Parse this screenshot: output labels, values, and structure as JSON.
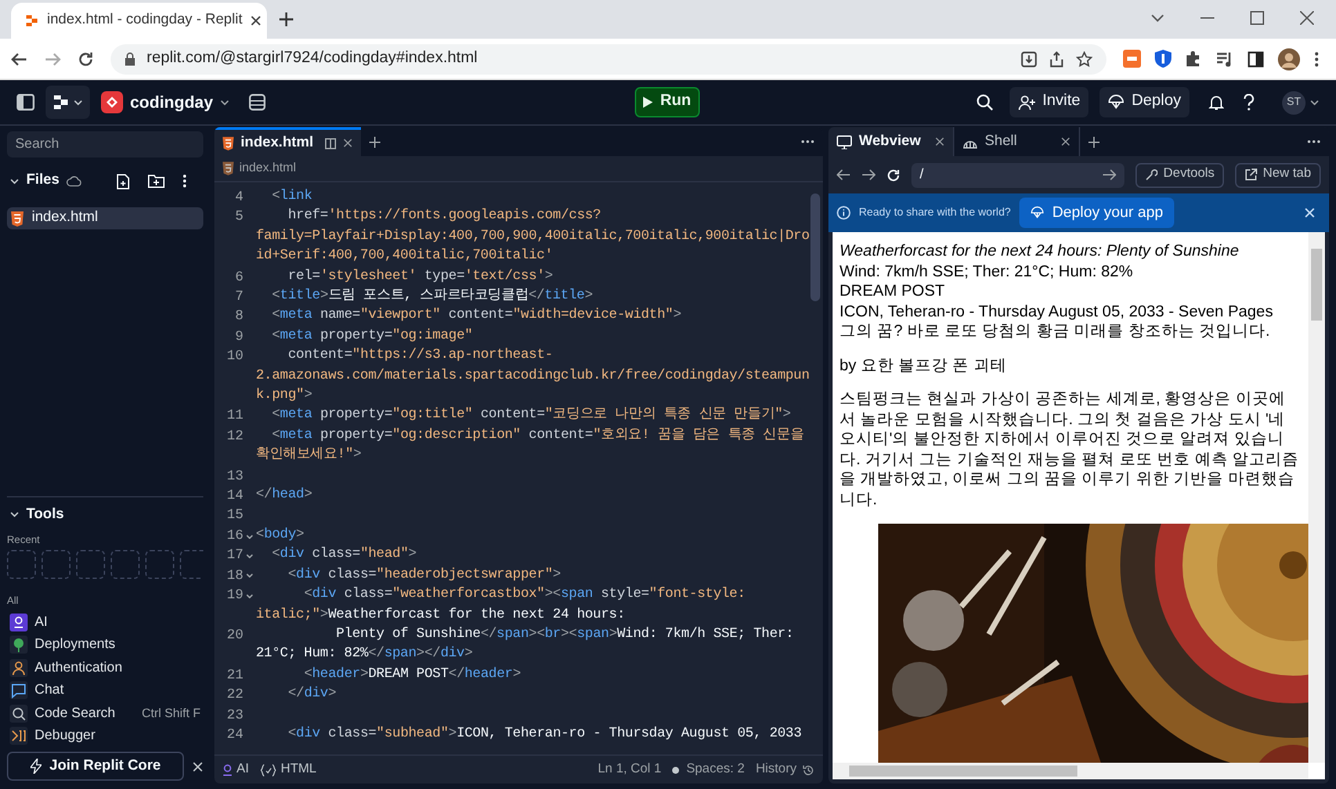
{
  "browser": {
    "tab_title": "index.html - codingday - Replit",
    "url": "replit.com/@stargirl7924/codingday#index.html"
  },
  "topbar": {
    "project": "codingday",
    "run": "Run",
    "invite": "Invite",
    "deploy": "Deploy",
    "avatar": "ST"
  },
  "sidebar": {
    "search_placeholder": "Search",
    "files_title": "Files",
    "files": [
      {
        "name": "index.html",
        "selected": true
      }
    ],
    "tools_title": "Tools",
    "recent_label": "Recent",
    "all_label": "All",
    "tools": [
      {
        "kind": "ai",
        "label": "AI"
      },
      {
        "kind": "deployments",
        "label": "Deployments"
      },
      {
        "kind": "auth",
        "label": "Authentication"
      },
      {
        "kind": "chat",
        "label": "Chat"
      },
      {
        "kind": "search",
        "label": "Code Search",
        "shortcut": "Ctrl Shift F"
      },
      {
        "kind": "debugger",
        "label": "Debugger"
      }
    ],
    "join_button": "Join Replit Core"
  },
  "editor": {
    "tabs": [
      {
        "label": "index.html",
        "selected": true
      }
    ],
    "breadcrumb": "index.html",
    "lines": [
      {
        "number": "4",
        "fold": false,
        "tokens": [
          {
            "kind": "punct",
            "text": "  <"
          },
          {
            "kind": "tag",
            "text": "link"
          }
        ]
      },
      {
        "number": "5",
        "fold": false,
        "tokens": [
          {
            "kind": "attr",
            "text": "    href="
          },
          {
            "kind": "string",
            "text": "'https://fonts.googleapis.com/css?"
          }
        ]
      },
      {
        "tokens": [
          {
            "kind": "string",
            "text": "family=Playfair+Display:400,700,900,400italic,700italic,900italic|Dro"
          }
        ]
      },
      {
        "tokens": [
          {
            "kind": "string",
            "text": "id+Serif:400,700,400italic,700italic'"
          }
        ]
      },
      {
        "number": "6",
        "fold": false,
        "tokens": [
          {
            "kind": "attr",
            "text": "    rel="
          },
          {
            "kind": "string",
            "text": "'stylesheet'"
          },
          {
            "kind": "attr",
            "text": " type="
          },
          {
            "kind": "string",
            "text": "'text/css'"
          },
          {
            "kind": "punct",
            "text": ">"
          }
        ]
      },
      {
        "number": "7",
        "fold": false,
        "tokens": [
          {
            "kind": "punct",
            "text": "  <"
          },
          {
            "kind": "tag",
            "text": "title"
          },
          {
            "kind": "punct",
            "text": ">"
          },
          {
            "kind": "text",
            "text": "드림 포스트, 스파르타코딩클럽"
          },
          {
            "kind": "punct",
            "text": "</"
          },
          {
            "kind": "tag",
            "text": "title"
          },
          {
            "kind": "punct",
            "text": ">"
          }
        ]
      },
      {
        "number": "8",
        "fold": false,
        "tokens": [
          {
            "kind": "punct",
            "text": "  <"
          },
          {
            "kind": "tag",
            "text": "meta"
          },
          {
            "kind": "attr",
            "text": " name="
          },
          {
            "kind": "string",
            "text": "\"viewport\""
          },
          {
            "kind": "attr",
            "text": " content="
          },
          {
            "kind": "string",
            "text": "\"width=device-width\""
          },
          {
            "kind": "punct",
            "text": ">"
          }
        ]
      },
      {
        "number": "9",
        "fold": false,
        "tokens": [
          {
            "kind": "punct",
            "text": "  <"
          },
          {
            "kind": "tag",
            "text": "meta"
          },
          {
            "kind": "attr",
            "text": " property="
          },
          {
            "kind": "string",
            "text": "\"og:image\""
          }
        ]
      },
      {
        "number": "10",
        "fold": false,
        "tokens": [
          {
            "kind": "attr",
            "text": "    content="
          },
          {
            "kind": "string",
            "text": "\"https://s3.ap-northeast-"
          }
        ]
      },
      {
        "tokens": [
          {
            "kind": "string",
            "text": "2.amazonaws.com/materials.spartacodingclub.kr/free/codingday/steampun"
          }
        ]
      },
      {
        "tokens": [
          {
            "kind": "string",
            "text": "k.png\""
          },
          {
            "kind": "punct",
            "text": ">"
          }
        ]
      },
      {
        "number": "11",
        "fold": false,
        "tokens": [
          {
            "kind": "punct",
            "text": "  <"
          },
          {
            "kind": "tag",
            "text": "meta"
          },
          {
            "kind": "attr",
            "text": " property="
          },
          {
            "kind": "string",
            "text": "\"og:title\""
          },
          {
            "kind": "attr",
            "text": " content="
          },
          {
            "kind": "string",
            "text": "\"코딩으로 나만의 특종 신문 만들기\""
          },
          {
            "kind": "punct",
            "text": ">"
          }
        ]
      },
      {
        "number": "12",
        "fold": false,
        "tokens": [
          {
            "kind": "punct",
            "text": "  <"
          },
          {
            "kind": "tag",
            "text": "meta"
          },
          {
            "kind": "attr",
            "text": " property="
          },
          {
            "kind": "string",
            "text": "\"og:description\""
          },
          {
            "kind": "attr",
            "text": " content="
          },
          {
            "kind": "string",
            "text": "\"호외요! 꿈을 담은 특종 신문을"
          }
        ]
      },
      {
        "tokens": [
          {
            "kind": "string",
            "text": "확인해보세요!\""
          },
          {
            "kind": "punct",
            "text": ">"
          }
        ]
      },
      {
        "number": "13",
        "fold": false
      },
      {
        "number": "14",
        "fold": false,
        "tokens": [
          {
            "kind": "punct",
            "text": "</"
          },
          {
            "kind": "tag",
            "text": "head"
          },
          {
            "kind": "punct",
            "text": ">"
          }
        ]
      },
      {
        "number": "15",
        "fold": false
      },
      {
        "number": "16",
        "fold": true,
        "tokens": [
          {
            "kind": "punct",
            "text": "<"
          },
          {
            "kind": "tag",
            "text": "body"
          },
          {
            "kind": "punct",
            "text": ">"
          }
        ]
      },
      {
        "number": "17",
        "fold": true,
        "tokens": [
          {
            "kind": "punct",
            "text": "  <"
          },
          {
            "kind": "tag",
            "text": "div"
          },
          {
            "kind": "attr",
            "text": " class="
          },
          {
            "kind": "string",
            "text": "\"head\""
          },
          {
            "kind": "punct",
            "text": ">"
          }
        ]
      },
      {
        "number": "18",
        "fold": true,
        "tokens": [
          {
            "kind": "punct",
            "text": "    <"
          },
          {
            "kind": "tag",
            "text": "div"
          },
          {
            "kind": "attr",
            "text": " class="
          },
          {
            "kind": "string",
            "text": "\"headerobjectswrapper\""
          },
          {
            "kind": "punct",
            "text": ">"
          }
        ]
      },
      {
        "number": "19",
        "fold": true,
        "tokens": [
          {
            "kind": "punct",
            "text": "      <"
          },
          {
            "kind": "tag",
            "text": "div"
          },
          {
            "kind": "attr",
            "text": " class="
          },
          {
            "kind": "string",
            "text": "\"weatherforcastbox\""
          },
          {
            "kind": "punct",
            "text": "><"
          },
          {
            "kind": "tag",
            "text": "span"
          },
          {
            "kind": "attr",
            "text": " style="
          },
          {
            "kind": "string",
            "text": "\"font-style:"
          }
        ]
      },
      {
        "tokens": [
          {
            "kind": "string",
            "text": "italic;\""
          },
          {
            "kind": "punct",
            "text": ">"
          },
          {
            "kind": "text",
            "text": "Weatherforcast for the next 24 hours:"
          }
        ]
      },
      {
        "number": "20",
        "fold": false,
        "tokens": [
          {
            "kind": "text",
            "text": "          Plenty of Sunshine"
          },
          {
            "kind": "punct",
            "text": "</"
          },
          {
            "kind": "tag",
            "text": "span"
          },
          {
            "kind": "punct",
            "text": "><"
          },
          {
            "kind": "tag",
            "text": "br"
          },
          {
            "kind": "punct",
            "text": "><"
          },
          {
            "kind": "tag",
            "text": "span"
          },
          {
            "kind": "punct",
            "text": ">"
          },
          {
            "kind": "text",
            "text": "Wind: 7km/h SSE; Ther:"
          }
        ]
      },
      {
        "tokens": [
          {
            "kind": "text",
            "text": "21°C; Hum: 82%"
          },
          {
            "kind": "punct",
            "text": "</"
          },
          {
            "kind": "tag",
            "text": "span"
          },
          {
            "kind": "punct",
            "text": "></"
          },
          {
            "kind": "tag",
            "text": "div"
          },
          {
            "kind": "punct",
            "text": ">"
          }
        ]
      },
      {
        "number": "21",
        "fold": false,
        "tokens": [
          {
            "kind": "punct",
            "text": "      <"
          },
          {
            "kind": "tag",
            "text": "header"
          },
          {
            "kind": "punct",
            "text": ">"
          },
          {
            "kind": "text",
            "text": "DREAM POST"
          },
          {
            "kind": "punct",
            "text": "</"
          },
          {
            "kind": "tag",
            "text": "header"
          },
          {
            "kind": "punct",
            "text": ">"
          }
        ]
      },
      {
        "number": "22",
        "fold": false,
        "tokens": [
          {
            "kind": "punct",
            "text": "    </"
          },
          {
            "kind": "tag",
            "text": "div"
          },
          {
            "kind": "punct",
            "text": ">"
          }
        ]
      },
      {
        "number": "23",
        "fold": false
      },
      {
        "number": "24",
        "fold": false,
        "tokens": [
          {
            "kind": "punct",
            "text": "    <"
          },
          {
            "kind": "tag",
            "text": "div"
          },
          {
            "kind": "attr",
            "text": " class="
          },
          {
            "kind": "string",
            "text": "\"subhead\""
          },
          {
            "kind": "punct",
            "text": ">"
          },
          {
            "kind": "text",
            "text": "ICON, Teheran-ro - Thursday August 05, 2033"
          }
        ]
      }
    ],
    "status": {
      "ai": "AI",
      "language": "HTML",
      "position": "Ln 1, Col 1",
      "spaces": "Spaces: 2",
      "history": "History"
    }
  },
  "webview": {
    "tabs": [
      {
        "kind": "webview",
        "label": "Webview",
        "selected": true
      },
      {
        "kind": "shell",
        "label": "Shell",
        "selected": false
      }
    ],
    "url": "/",
    "devtools": "Devtools",
    "new_tab": "New tab",
    "banner": {
      "message": "Ready to share with the world?",
      "button": "Deploy your app"
    },
    "content": [
      {
        "kind": "line",
        "italic": true,
        "text": "Weatherforcast for the next 24 hours: Plenty of Sunshine"
      },
      {
        "kind": "line",
        "italic": false,
        "text": "Wind: 7km/h SSE; Ther: 21°C; Hum: 82%"
      },
      {
        "kind": "line",
        "italic": false,
        "text": "DREAM POST"
      },
      {
        "kind": "line",
        "italic": false,
        "text": "ICON, Teheran-ro - Thursday August 05, 2033 - Seven Pages"
      },
      {
        "kind": "line",
        "italic": false,
        "text": "그의 꿈? 바로 로또 당첨의 황금 미래를 창조하는 것입니다."
      },
      {
        "kind": "paragraph",
        "italic": false,
        "text": "by 요한 볼프강 폰 괴테"
      },
      {
        "kind": "paragraph",
        "italic": false,
        "text": "스팀펑크는 현실과 가상이 공존하는 세계로, 황영상은 이곳에서 놀라운 모험을 시작했습니다. 그의 첫 걸음은 가상 도시 '네오시티'의 불안정한 지하에서 이루어진 것으로 알려져 있습니다. 거기서 그는 기술적인 재능을 펼쳐 로또 번호 예측 알고리즘을 개발하였고, 이로써 그의 꿈을 이루기 위한 기반을 마련했습니다."
      },
      {
        "kind": "picture"
      }
    ]
  }
}
